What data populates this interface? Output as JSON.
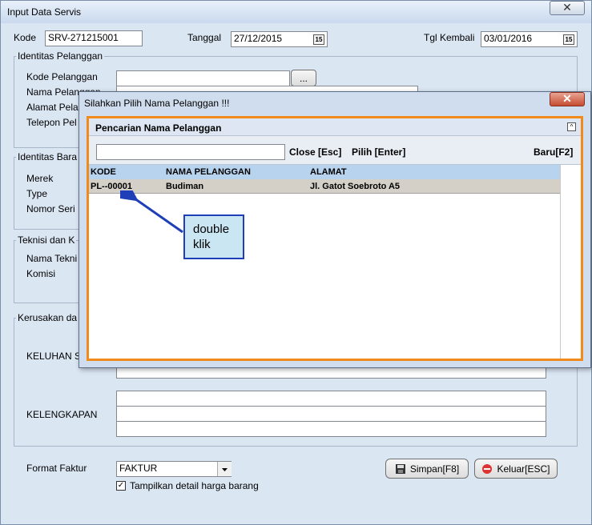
{
  "window": {
    "title": "Input Data Servis",
    "close_glyph": "✕"
  },
  "header": {
    "kode_label": "Kode",
    "kode_value": "SRV-271215001",
    "tanggal_label": "Tanggal",
    "tanggal_value": "27/12/2015",
    "tgl_kembali_label": "Tgl Kembali",
    "tgl_kembali_value": "03/01/2016",
    "calendar_glyph": "15"
  },
  "identitas_pelanggan": {
    "legend": "Identitas Pelanggan",
    "kode_label": "Kode Pelanggan",
    "nama_label": "Nama Pelanggan",
    "alamat_label": "Alamat Pela",
    "telepon_label": "Telepon Pel",
    "browse_label": "..."
  },
  "identitas_barang": {
    "legend": "Identitas Bara",
    "merek_label": "Merek",
    "type_label": "Type",
    "nomor_seri_label": "Nomor Seri"
  },
  "teknisi": {
    "legend": "Teknisi dan K",
    "nama_label": "Nama Tekni",
    "komisi_label": "Komisi"
  },
  "kerusakan": {
    "legend": "Kerusakan da",
    "keluhan_label": "KELUHAN SI",
    "kelengkapan_label": "KELENGKAPAN"
  },
  "footer": {
    "format_label": "Format Faktur",
    "format_value": "FAKTUR",
    "checkbox_label": "Tampilkan detail harga barang",
    "checkbox_glyph": "✓",
    "simpan_label": "Simpan[F8]",
    "keluar_label": "Keluar[ESC]"
  },
  "dialog": {
    "title": "Silahkan Pilih Nama Pelanggan !!!",
    "close_glyph": "✕",
    "panel_title": "Pencarian Nama Pelanggan",
    "collapse_glyph": "^",
    "search_value": "",
    "close_label": "Close [Esc]",
    "pilih_label": "Pilih [Enter]",
    "baru_label": "Baru[F2]",
    "columns": [
      "KODE",
      "NAMA PELANGGAN",
      "ALAMAT"
    ],
    "rows": [
      {
        "kode": "PL--00001",
        "nama": "Budiman",
        "alamat": "Jl. Gatot Soebroto A5"
      }
    ]
  },
  "annotation": {
    "line1": "double",
    "line2": "klik",
    "color": "#1f3fb8"
  },
  "colors": {
    "accent_orange": "#f08a1a",
    "grid_header": "#b8d3ee",
    "window_bg": "#dbe6f3"
  }
}
